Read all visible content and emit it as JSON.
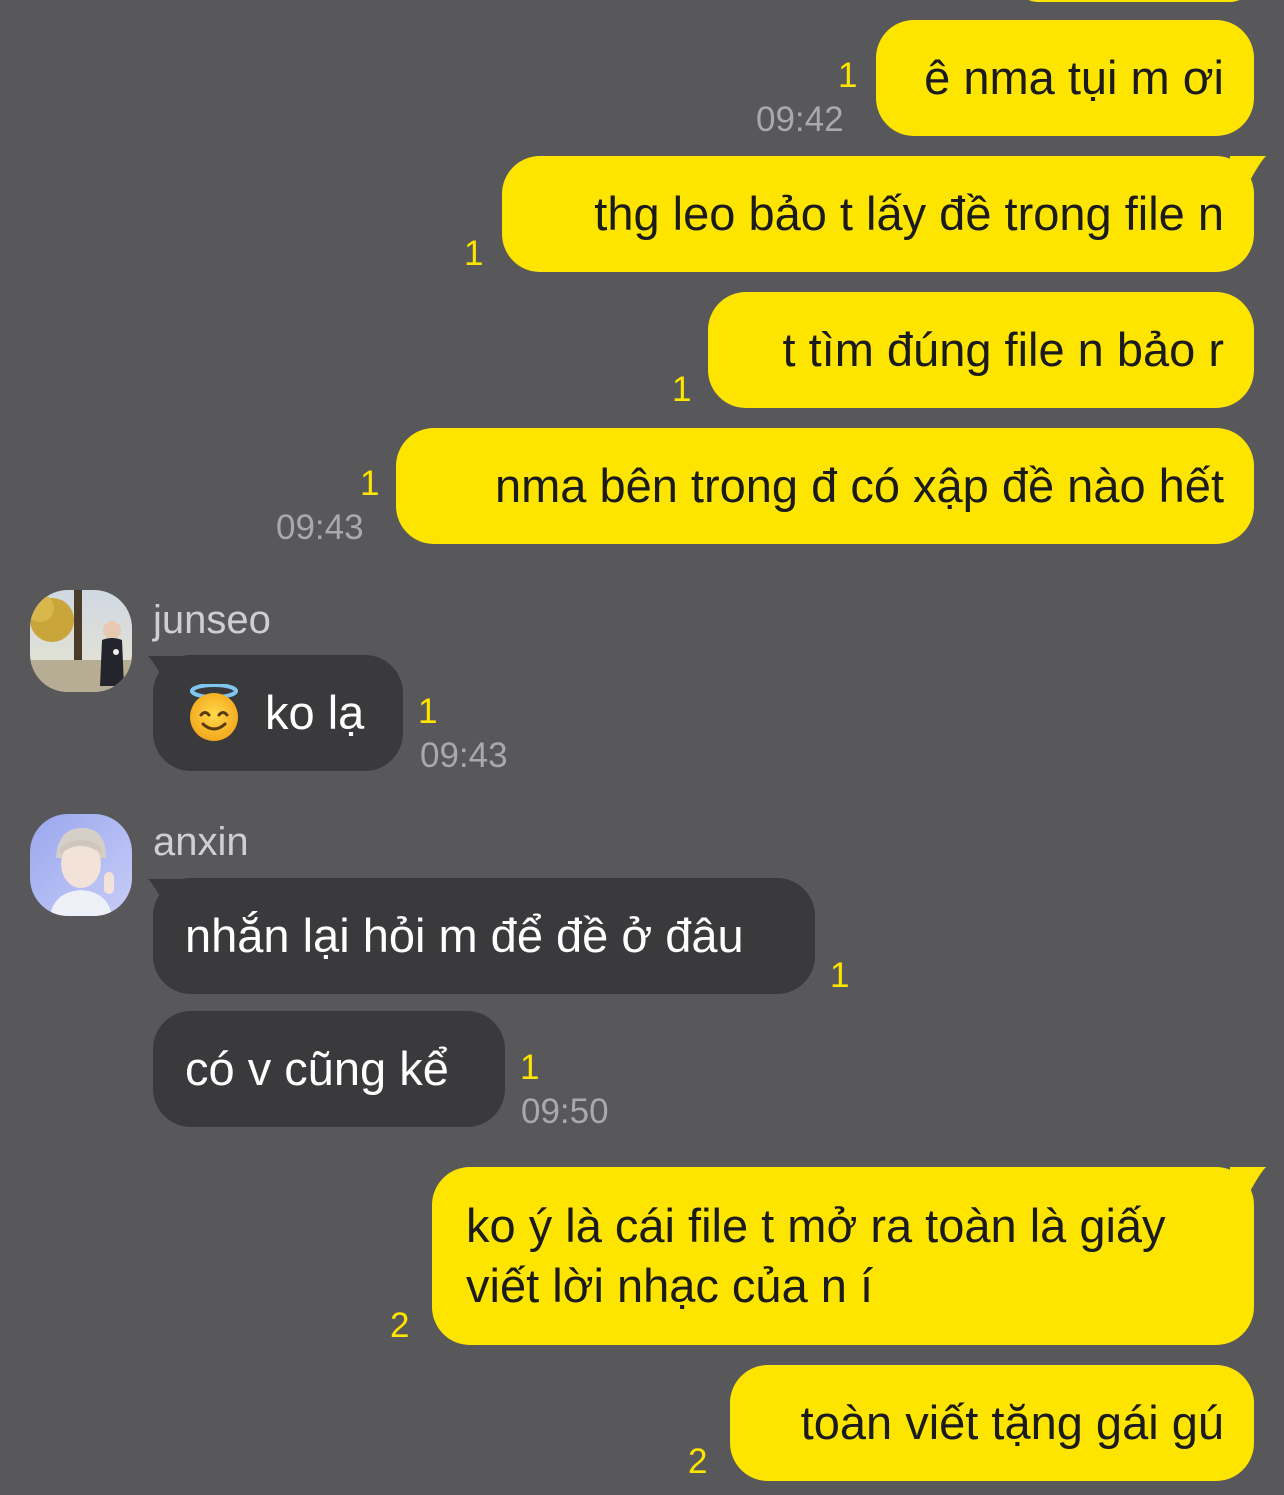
{
  "messages": {
    "m1": {
      "text": "ê nma tụi m ơi",
      "unread": "1",
      "time": "09:42"
    },
    "m2": {
      "text": "thg leo bảo t lấy đề trong file n",
      "unread": "1"
    },
    "m3": {
      "text": "t tìm đúng file n bảo r",
      "unread": "1"
    },
    "m4": {
      "text": "nma bên trong đ có xập đề nào hết",
      "unread": "1",
      "time": "09:43"
    },
    "m5": {
      "sender": "junseo",
      "emoji": "smiling-face-with-halo",
      "text": "ko lạ",
      "unread": "1",
      "time": "09:43"
    },
    "m6": {
      "sender": "anxin",
      "text": "nhắn lại hỏi m để đề ở đâu",
      "unread": "1"
    },
    "m7": {
      "text": "có v cũng kể",
      "unread": "1",
      "time": "09:50"
    },
    "m8": {
      "text": "ko ý là cái file t mở ra toàn là giấy viết lời nhạc của n í",
      "unread": "2"
    },
    "m9": {
      "text": "toàn viết tặng gái gú",
      "unread": "2"
    }
  },
  "colors": {
    "background": "#58575a",
    "outgoing_bubble": "#fde500",
    "incoming_bubble": "#3a3a3d",
    "unread_count": "#fde500",
    "timestamp": "#a9a8ab"
  }
}
